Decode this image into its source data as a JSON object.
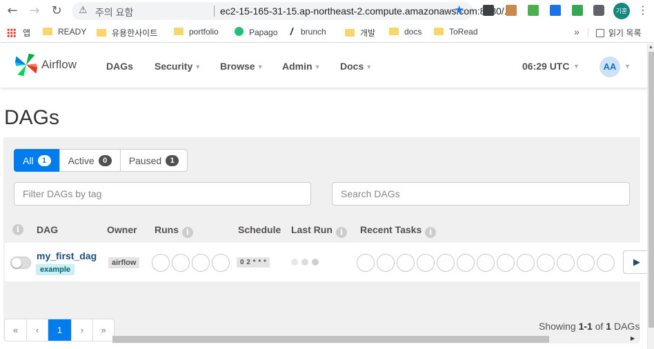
{
  "browser": {
    "security_label": "주의 요함",
    "url": "ec2-15-165-31-15.ap-northeast-2.compute.amazonaws.com:8080/...",
    "profile_label": "기훈",
    "bookmarks": [
      "앱",
      "READY",
      "유용한사이트",
      "portfolio",
      "Papago",
      "brunch",
      "개발",
      "docs",
      "ToRead"
    ],
    "more_bookmarks": "»",
    "reading_list": "읽기 목록"
  },
  "navbar": {
    "brand": "Airflow",
    "items": [
      "DAGs",
      "Security",
      "Browse",
      "Admin",
      "Docs"
    ],
    "clock": "06:29 UTC",
    "avatar": "AA"
  },
  "page": {
    "title": "DAGs",
    "filters": [
      {
        "label": "All",
        "count": "1"
      },
      {
        "label": "Active",
        "count": "0"
      },
      {
        "label": "Paused",
        "count": "1"
      }
    ],
    "tag_filter_placeholder": "Filter DAGs by tag",
    "search_placeholder": "Search DAGs",
    "columns": [
      "DAG",
      "Owner",
      "Runs",
      "Schedule",
      "Last Run",
      "Recent Tasks"
    ],
    "row": {
      "dag_id": "my_first_dag",
      "tag": "example",
      "owner": "airflow",
      "schedule": "0 2 * * *"
    },
    "pagination": [
      "«",
      "‹",
      "1",
      "›",
      "»"
    ],
    "showing": {
      "prefix": "Showing ",
      "range": "1-1",
      "middle": " of ",
      "total": "1",
      "suffix": " DAGs"
    }
  },
  "colors": {
    "accent": "#017cee",
    "tag_bg": "#c9eff3",
    "dag_link": "#1a4e7a"
  }
}
